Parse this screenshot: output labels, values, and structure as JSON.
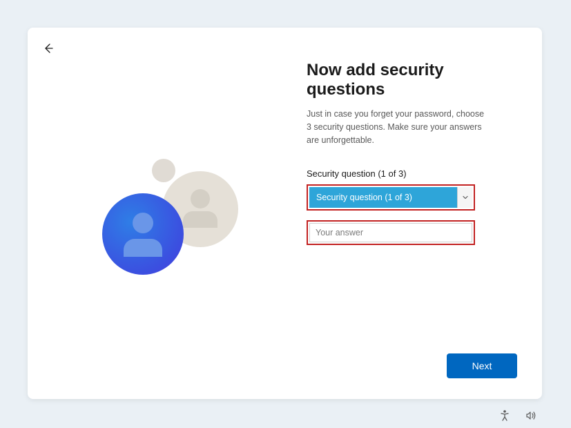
{
  "heading": "Now add security questions",
  "subheading": "Just in case you forget your password, choose 3 security questions. Make sure your answers are unforgettable.",
  "field": {
    "label": "Security question (1 of 3)",
    "dropdown_value": "Security question (1 of 3)",
    "answer_placeholder": "Your answer"
  },
  "buttons": {
    "next": "Next"
  }
}
